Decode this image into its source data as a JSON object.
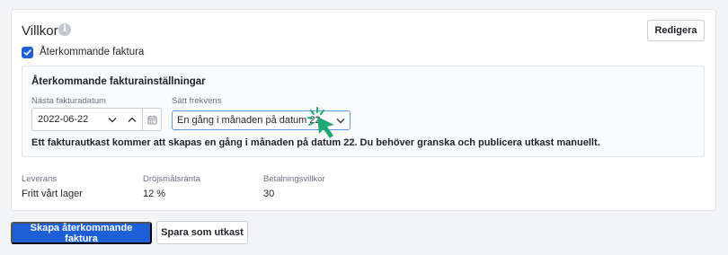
{
  "section": {
    "title": "Villkor",
    "edit_label": "Redigera",
    "checkbox_label": "Återkommande faktura",
    "checkbox_checked": true
  },
  "settings": {
    "title": "Återkommande fakturainställningar",
    "next_date_label": "Nästa fakturadatum",
    "next_date_value": "2022-06-22",
    "frequency_label": "Sätt frekvens",
    "frequency_value": "En gång i månaden på datum 22",
    "note": "Ett fakturautkast kommer att skapas en gång i månaden på datum 22. Du behöver granska och publicera utkast manuellt."
  },
  "meta": [
    {
      "label": "Leverans",
      "value": "Fritt vårt lager"
    },
    {
      "label": "Dröjsmålsränta",
      "value": "12 %"
    },
    {
      "label": "Betalningsvillkor",
      "value": "30"
    }
  ],
  "actions": {
    "primary_label": "Skapa återkommande faktura",
    "secondary_label": "Spara som utkast"
  },
  "icons": {
    "info": "info-icon",
    "check": "check-icon",
    "calendar": "calendar-icon",
    "chevron_down": "chevron-down-icon",
    "chevron_up": "chevron-up-icon",
    "cursor": "pointer-cursor-icon"
  },
  "colors": {
    "primary": "#1d5fd6",
    "focus_border": "#5b9be0",
    "cursor": "#1fa774"
  }
}
